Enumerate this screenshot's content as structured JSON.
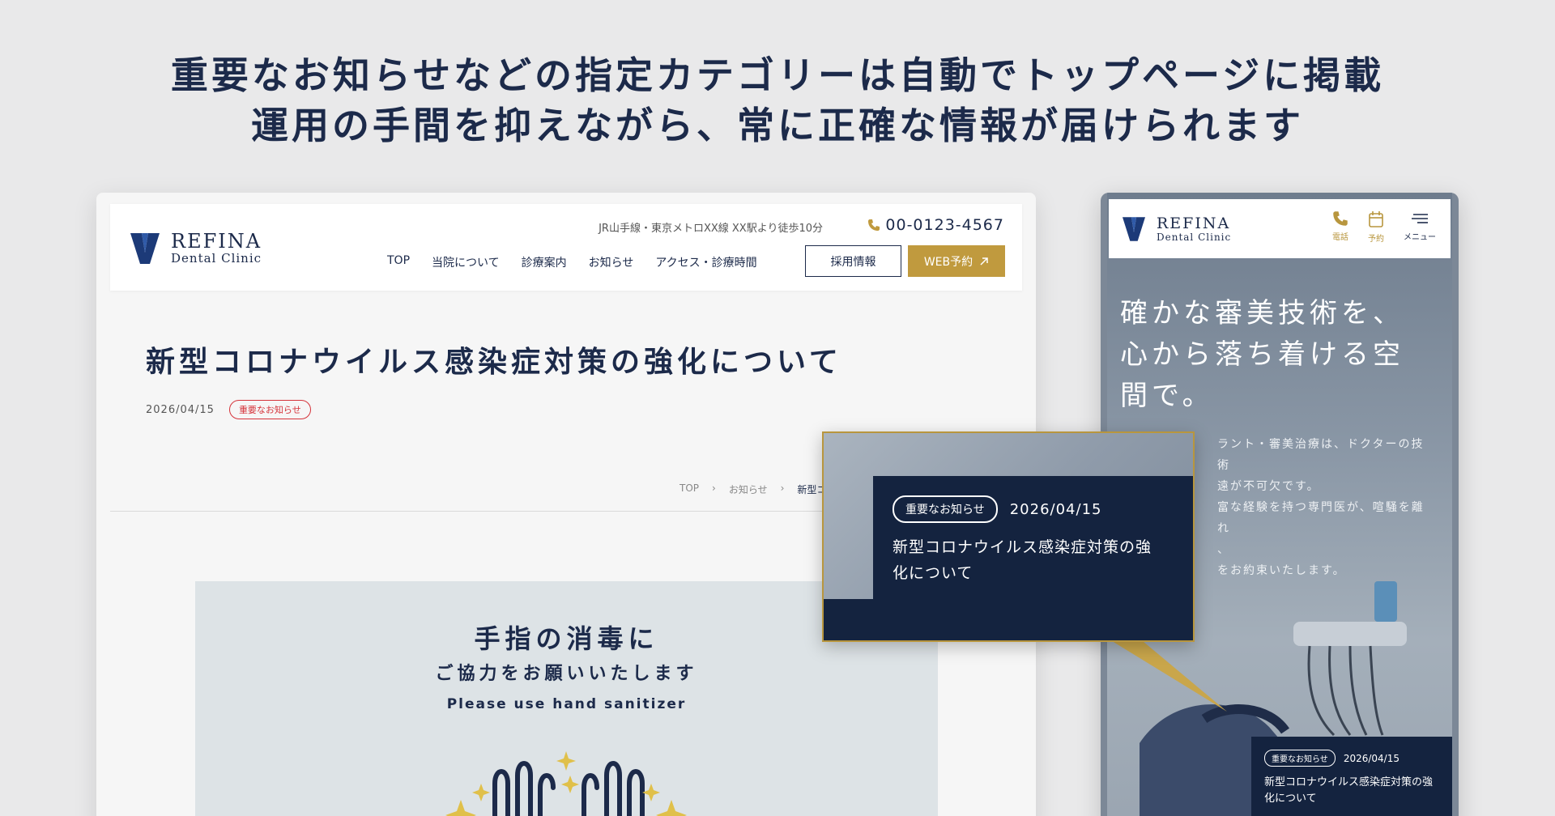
{
  "headline": {
    "line1": "重要なお知らせなどの指定カテゴリーは自動でトップページに掲載",
    "line2": "運用の手間を抑えながら、常に正確な情報が届けられます"
  },
  "brand": {
    "name": "REFINA",
    "sub": "Dental Clinic",
    "color_navy": "#1c2a4a",
    "color_gold": "#c09a3e"
  },
  "desktop": {
    "access": "JR山手線・東京メトロXX線 XX駅より徒歩10分",
    "phone": "00-0123-4567",
    "nav": [
      "TOP",
      "当院について",
      "診療案内",
      "お知らせ",
      "アクセス・診療時間"
    ],
    "recruit": "採用情報",
    "web_reserve": "WEB予約",
    "post_title": "新型コロナウイルス感染症対策の強化について",
    "post_date": "2026/04/15",
    "post_tag": "重要なお知らせ",
    "breadcrumb": [
      "TOP",
      "お知らせ",
      "新型コ"
    ],
    "poster": {
      "h1": "手指の消毒に",
      "h2": "ご協力をお願いいたします",
      "en": "Please use hand sanitizer"
    }
  },
  "mobile": {
    "icons": [
      {
        "icon": "phone-icon",
        "label": "電話"
      },
      {
        "icon": "calendar-icon",
        "label": "予約"
      },
      {
        "icon": "menu-icon",
        "label": "メニュー"
      }
    ],
    "hero_lines": [
      "確かな審美技術を、",
      "心から落ち着ける空",
      "間で。"
    ],
    "hero_sub": [
      "ラント・審美治療は、ドクターの技術",
      "遠が不可欠です。",
      "富な経験を持つ専門医が、喧騒を離れ",
      "、",
      "をお約束いたします。"
    ],
    "news_tag": "重要なお知らせ",
    "news_date": "2026/04/15",
    "news_title": "新型コロナウイルス感染症対策の強化について"
  },
  "callout": {
    "tag": "重要なお知らせ",
    "date": "2026/04/15",
    "title_line1": "新型コロナウイルス感染症対策の強",
    "title_line2": "化について"
  }
}
